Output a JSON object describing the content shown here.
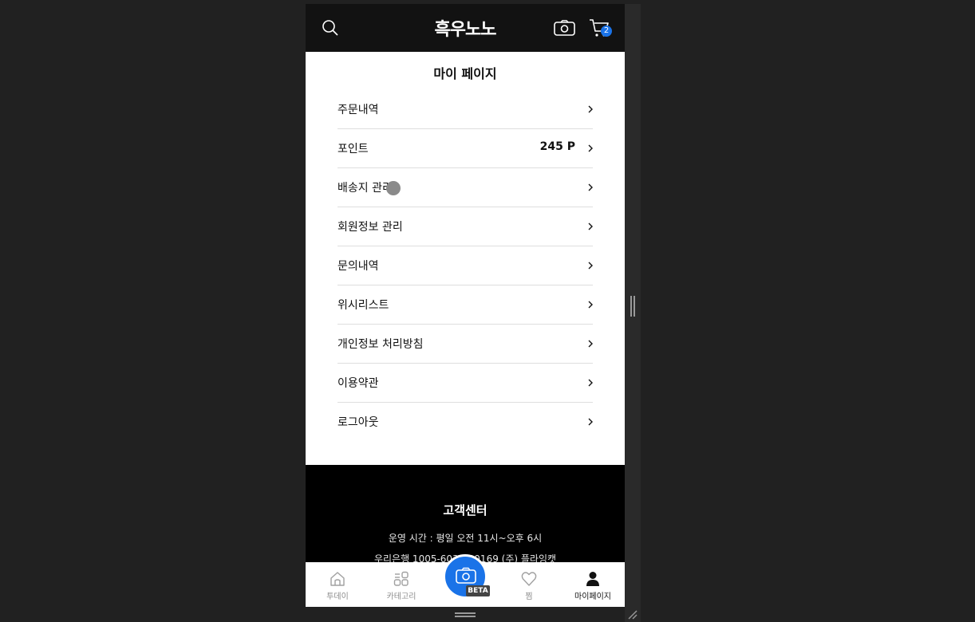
{
  "header": {
    "logo": "흑우노노",
    "cart_count": "2"
  },
  "page": {
    "title": "마이 페이지"
  },
  "menu": {
    "items": [
      {
        "label": "주문내역",
        "value": ""
      },
      {
        "label": "포인트",
        "value": "245 P"
      },
      {
        "label": "배송지 관리",
        "value": ""
      },
      {
        "label": "회원정보 관리",
        "value": ""
      },
      {
        "label": "문의내역",
        "value": ""
      },
      {
        "label": "위시리스트",
        "value": ""
      },
      {
        "label": "개인정보 처리방침",
        "value": ""
      },
      {
        "label": "이용약관",
        "value": ""
      },
      {
        "label": "로그아웃",
        "value": ""
      }
    ]
  },
  "footer": {
    "title": "고객센터",
    "hours": "운영 시간 : 평일 오전 11시~오후 6시",
    "bank": "우리은행 1005-603-180169 (주) 플라잉캣"
  },
  "bottom_nav": {
    "items": [
      {
        "label": "투데이"
      },
      {
        "label": "카테고리"
      },
      {
        "label": ""
      },
      {
        "label": "찜"
      },
      {
        "label": "마이페이지"
      }
    ],
    "fab_badge": "BETA"
  },
  "colors": {
    "accent": "#1a73e8",
    "header_bg": "#121212",
    "footer_bg": "#000000"
  },
  "icons": [
    "search-icon",
    "camera-icon",
    "cart-icon",
    "chevron-right-icon",
    "home-icon",
    "category-icon",
    "heart-icon",
    "user-icon"
  ]
}
